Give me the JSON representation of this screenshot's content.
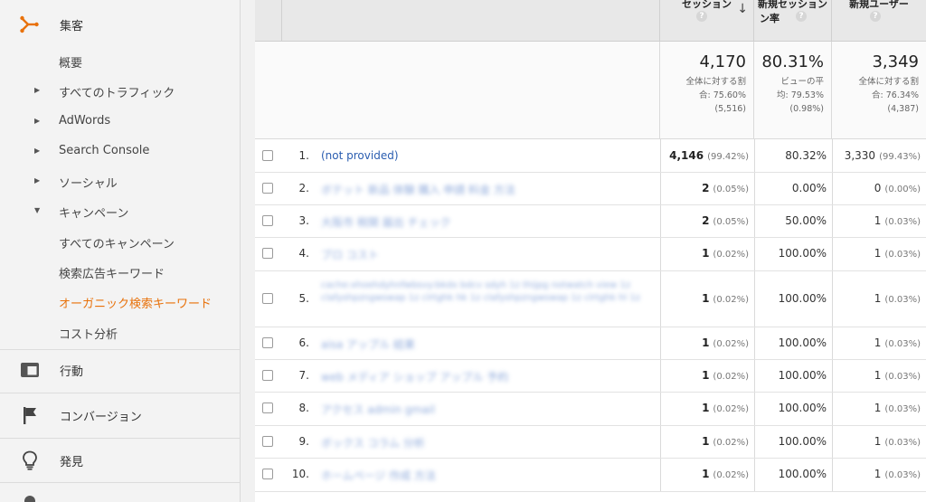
{
  "sidebar": {
    "acquisition": {
      "label": "集客",
      "icon": "acquisition-icon"
    },
    "items": [
      {
        "label": "概要",
        "arrow": ""
      },
      {
        "label": "すべてのトラフィック",
        "arrow": "▶"
      },
      {
        "label": "AdWords",
        "arrow": "▶"
      },
      {
        "label": "Search Console",
        "arrow": "▶"
      },
      {
        "label": "ソーシャル",
        "arrow": "▶"
      },
      {
        "label": "キャンペーン",
        "arrow": "▼"
      },
      {
        "label": "すべてのキャンペーン",
        "arrow": ""
      },
      {
        "label": "検索広告キーワード",
        "arrow": ""
      },
      {
        "label": "オーガニック検索キーワード",
        "arrow": "",
        "active": true
      },
      {
        "label": "コスト分析",
        "arrow": ""
      }
    ],
    "behavior": {
      "label": "行動",
      "icon": "behavior-icon"
    },
    "conversions": {
      "label": "コンバージョン",
      "icon": "flag-icon"
    },
    "discover": {
      "label": "発見",
      "icon": "lightbulb-icon"
    },
    "accent_color": "#e8710a"
  },
  "table": {
    "columns": {
      "sessions": {
        "title": "セッション",
        "help": "?"
      },
      "new_session_rate": {
        "title": "新規セッション",
        "title2": "ン率",
        "help": "?"
      },
      "new_users": {
        "title": "新規ユーザー",
        "help": "?"
      }
    },
    "totals": {
      "sessions": {
        "value": "4,170",
        "sub": "全体に対する割\n合: 75.60%\n(5,516)"
      },
      "new_session_rate": {
        "value": "80.31%",
        "sub": "ビューの平\n均: 79.53%\n(0.98%)"
      },
      "new_users": {
        "value": "3,349",
        "sub": "全体に対する割\n合: 76.34%\n(4,387)"
      }
    },
    "rows": [
      {
        "num": "1.",
        "keyword": "(not provided)",
        "sessions": "4,146",
        "sessions_pct": "(99.42%)",
        "rate": "80.32%",
        "users": "3,330",
        "users_pct": "(99.43%)"
      },
      {
        "num": "2.",
        "keyword": "ボテット 新品 体験 購入 申請 料金 方法",
        "sessions": "2",
        "sessions_pct": "(0.05%)",
        "rate": "0.00%",
        "users": "0",
        "users_pct": "(0.00%)"
      },
      {
        "num": "3.",
        "keyword": "大阪市 税関 届出 チェック",
        "sessions": "2",
        "sessions_pct": "(0.05%)",
        "rate": "50.00%",
        "users": "1",
        "users_pct": "(0.03%)"
      },
      {
        "num": "4.",
        "keyword": "ブロ コスト",
        "sessions": "1",
        "sessions_pct": "(0.02%)",
        "rate": "100.00%",
        "users": "1",
        "users_pct": "(0.03%)"
      },
      {
        "num": "5.",
        "keyword": "cache:xhoehdyhnfwbsvy:bkdx bdcv sdyh 1z thijpg notwatch view 1z clafyshpzngwswap 1z clrtghk hk 1z clafyshpzngwswap 1z clrtghk hl 1z",
        "sessions": "1",
        "sessions_pct": "(0.02%)",
        "rate": "100.00%",
        "users": "1",
        "users_pct": "(0.03%)"
      },
      {
        "num": "6.",
        "keyword": "aisa アップル 結果",
        "sessions": "1",
        "sessions_pct": "(0.02%)",
        "rate": "100.00%",
        "users": "1",
        "users_pct": "(0.03%)"
      },
      {
        "num": "7.",
        "keyword": "web メディア ショップ アップル 予約",
        "sessions": "1",
        "sessions_pct": "(0.02%)",
        "rate": "100.00%",
        "users": "1",
        "users_pct": "(0.03%)"
      },
      {
        "num": "8.",
        "keyword": "アクセス admin gmail",
        "sessions": "1",
        "sessions_pct": "(0.02%)",
        "rate": "100.00%",
        "users": "1",
        "users_pct": "(0.03%)"
      },
      {
        "num": "9.",
        "keyword": "ボックス コラム 分析",
        "sessions": "1",
        "sessions_pct": "(0.02%)",
        "rate": "100.00%",
        "users": "1",
        "users_pct": "(0.03%)"
      },
      {
        "num": "10.",
        "keyword": "ホームページ 作成 方法",
        "sessions": "1",
        "sessions_pct": "(0.02%)",
        "rate": "100.00%",
        "users": "1",
        "users_pct": "(0.03%)"
      }
    ]
  }
}
